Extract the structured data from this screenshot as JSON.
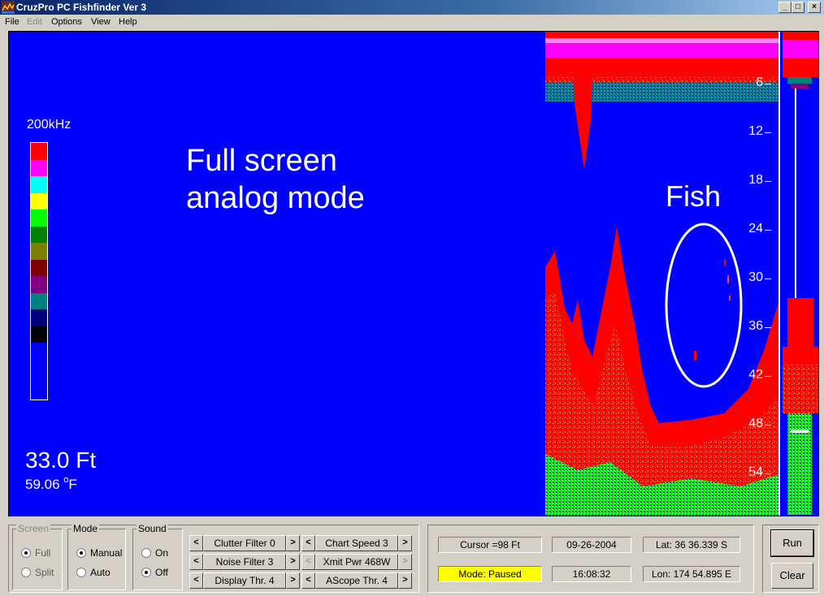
{
  "window": {
    "title": "CruzPro PC Fishfinder Ver 3"
  },
  "menu": {
    "file": "File",
    "edit": "Edit",
    "options": "Options",
    "view": "View",
    "help": "Help"
  },
  "display": {
    "frequency": "200kHz",
    "annotation_line1": "Full screen",
    "annotation_line2": "analog mode",
    "depth": "33.0 Ft",
    "temperature": "59.06",
    "temperature_unit": "F",
    "degree_symbol": "o",
    "fish_label": "Fish",
    "depth_ticks": [
      "6",
      "12",
      "18",
      "24",
      "30",
      "36",
      "42",
      "48",
      "54"
    ],
    "palette_colors": [
      "#ff0000",
      "#ff00ff",
      "#00ffff",
      "#ffff00",
      "#00ff00",
      "#008000",
      "#808000",
      "#800000",
      "#800080",
      "#008080",
      "#000080",
      "#000000"
    ]
  },
  "controls": {
    "screen": {
      "title": "Screen",
      "full": "Full",
      "split": "Split"
    },
    "mode": {
      "title": "Mode",
      "manual": "Manual",
      "auto": "Auto"
    },
    "sound": {
      "title": "Sound",
      "on": "On",
      "off": "Off"
    },
    "clutter_filter": "Clutter Filter 0",
    "noise_filter": "Noise Filter 3",
    "display_threshold": "Display Thr. 4",
    "chart_speed": "Chart Speed 3",
    "xmit_power": "Xmit Pwr 468W",
    "ascope_threshold": "AScope Thr. 4",
    "left_arrow": "<",
    "right_arrow": ">"
  },
  "status": {
    "cursor": "Cursor =98 Ft",
    "date": "09-26-2004",
    "latitude": "Lat: 36  36.339 S",
    "mode": "Mode: Paused",
    "time": "16:08:32",
    "longitude": "Lon: 174  54.895 E"
  },
  "buttons": {
    "run": "Run",
    "clear": "Clear"
  }
}
